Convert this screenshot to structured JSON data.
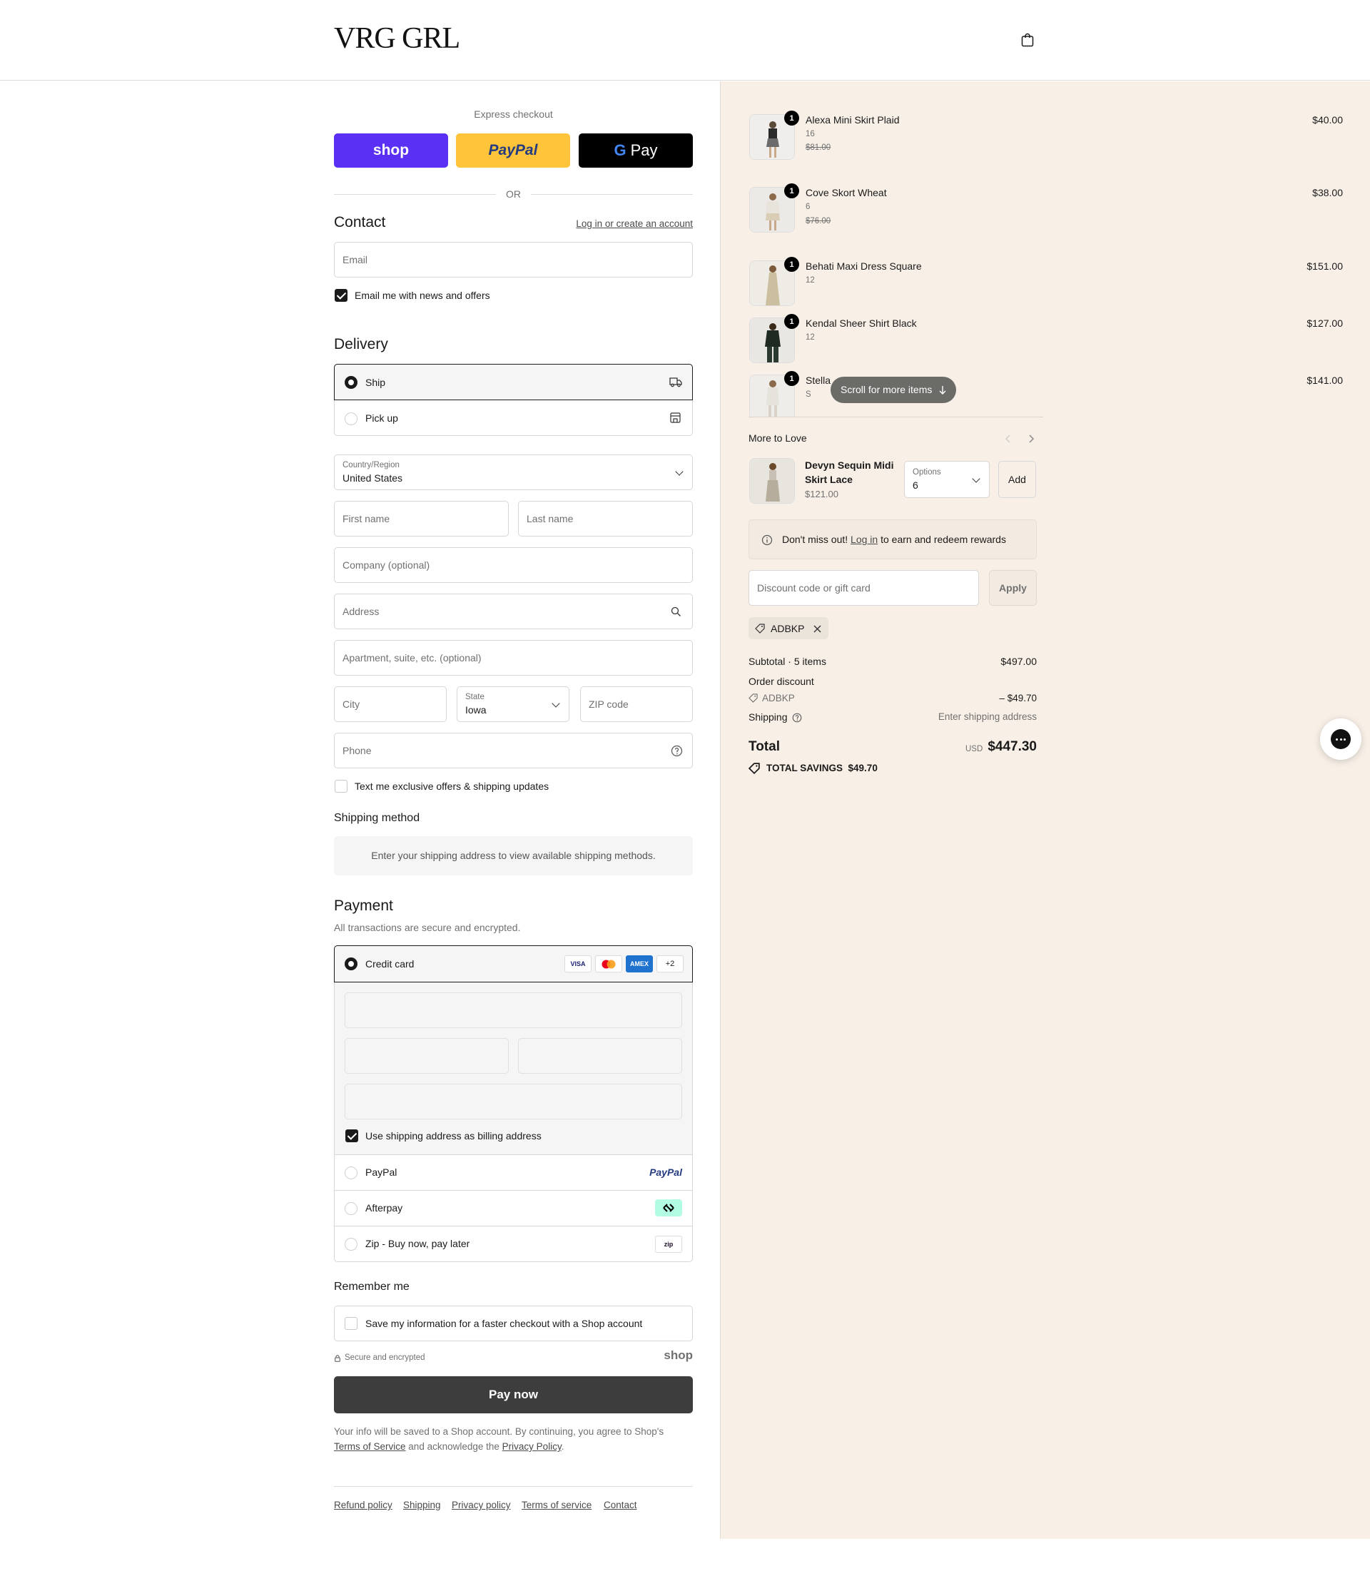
{
  "brand": {
    "name": "VRG GRL"
  },
  "express": {
    "title": "Express checkout",
    "shop": "shop",
    "paypal": "PayPal",
    "gpay": "Pay",
    "or": "OR"
  },
  "contact": {
    "title": "Contact",
    "login_link": "Log in or create an account",
    "email_placeholder": "Email",
    "news_label": "Email me with news and offers"
  },
  "delivery": {
    "title": "Delivery",
    "ship": "Ship",
    "pickup": "Pick up",
    "country_label": "Country/Region",
    "country_value": "United States",
    "first_name": "First name",
    "last_name": "Last name",
    "company": "Company (optional)",
    "address": "Address",
    "apartment": "Apartment, suite, etc. (optional)",
    "city": "City",
    "state_label": "State",
    "state_value": "Iowa",
    "zip": "ZIP code",
    "phone": "Phone",
    "sms_label": "Text me exclusive offers & shipping updates"
  },
  "shipping_method": {
    "title": "Shipping method",
    "message": "Enter your shipping address to view available shipping methods."
  },
  "payment": {
    "title": "Payment",
    "subtitle": "All transactions are secure and encrypted.",
    "credit_card": "Credit card",
    "cards": [
      "VISA",
      "MC",
      "AMEX",
      "+2"
    ],
    "billing_label": "Use shipping address as billing address",
    "paypal": "PayPal",
    "paypal_logo": "PayPal",
    "afterpay": "Afterpay",
    "zip": "Zip - Buy now, pay later",
    "zip_logo": "zip"
  },
  "remember": {
    "title": "Remember me",
    "label": "Save my information for a faster checkout with a Shop account",
    "secure": "Secure and encrypted",
    "shop_logo": "shop"
  },
  "pay_now": "Pay now",
  "legal": {
    "line1": "Your info will be saved to a Shop account. By continuing, you agree to Shop's",
    "tos": "Terms of Service",
    "mid": "and acknowledge the",
    "privacy": "Privacy Policy",
    "end": "."
  },
  "footer_links": [
    "Refund policy",
    "Shipping",
    "Privacy policy",
    "Terms of service",
    "Contact"
  ],
  "cart": {
    "items": [
      {
        "name": "Alexa Mini Skirt Plaid",
        "variant": "16",
        "compare": "$81.00",
        "price": "$40.00",
        "qty": "1"
      },
      {
        "name": "Cove Skort Wheat",
        "variant": "6",
        "compare": "$76.00",
        "price": "$38.00",
        "qty": "1"
      },
      {
        "name": "Behati Maxi Dress Square",
        "variant": "12",
        "compare": "",
        "price": "$151.00",
        "qty": "1"
      },
      {
        "name": "Kendal Sheer Shirt Black",
        "variant": "12",
        "compare": "",
        "price": "$127.00",
        "qty": "1"
      },
      {
        "name": "Stella",
        "variant": "S",
        "compare": "",
        "price": "$141.00",
        "qty": "1"
      }
    ],
    "scroll_hint": "Scroll for more items"
  },
  "upsell": {
    "title": "More to Love",
    "name": "Devyn Sequin Midi Skirt Lace",
    "price": "$121.00",
    "options_label": "Options",
    "options_value": "6",
    "add": "Add"
  },
  "rewards": {
    "pre": "Don't miss out!",
    "link": "Log in",
    "post": "to earn and redeem rewards"
  },
  "discount": {
    "placeholder": "Discount code or gift card",
    "apply": "Apply",
    "code": "ADBKP"
  },
  "totals": {
    "subtotal_label": "Subtotal · 5 items",
    "subtotal": "$497.00",
    "order_discount_label": "Order discount",
    "discount_code": "ADBKP",
    "discount_value": "– $49.70",
    "shipping_label": "Shipping",
    "shipping_value": "Enter shipping address",
    "total_label": "Total",
    "currency": "USD",
    "total": "$447.30",
    "savings_label": "TOTAL SAVINGS",
    "savings": "$49.70"
  }
}
